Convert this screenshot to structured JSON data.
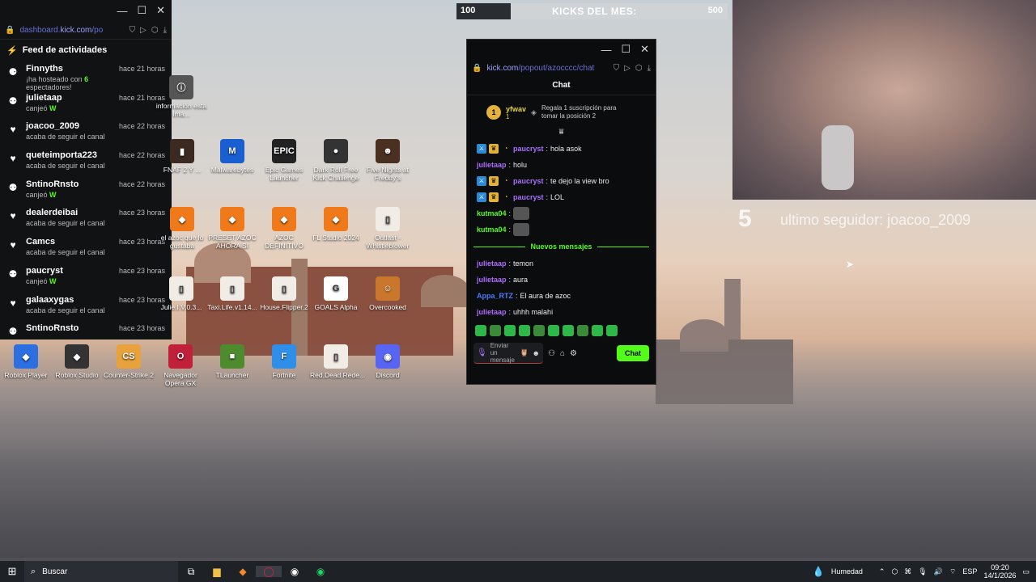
{
  "feed_window": {
    "controls": [
      "—",
      "☐",
      "✕"
    ],
    "url_prefix": "dashboard.",
    "url_host": "kick.com",
    "url_path": "/po",
    "header": "Feed de actividades",
    "items": [
      {
        "name": "Finnyths",
        "time": "hace 21 horas",
        "pre": "¡ha hosteado con ",
        "count": "6",
        "post": " espectadores!",
        "icon": "host-icon"
      },
      {
        "name": "julietaap",
        "time": "hace 21 horas",
        "pre": "canjeó ",
        "count": "W",
        "post": "",
        "icon": "redeem-icon"
      },
      {
        "name": "joacoo_2009",
        "time": "hace 22 horas",
        "pre": "acaba de seguir el canal",
        "count": "",
        "post": "",
        "icon": "heart-icon"
      },
      {
        "name": "queteimporta223",
        "time": "hace 22 horas",
        "pre": "acaba de seguir el canal",
        "count": "",
        "post": "",
        "icon": "heart-icon"
      },
      {
        "name": "SntinoRnsto",
        "time": "hace 22 horas",
        "pre": "canjeó ",
        "count": "W",
        "post": "",
        "icon": "redeem-icon"
      },
      {
        "name": "dealerdeibai",
        "time": "hace 23 horas",
        "pre": "acaba de seguir el canal",
        "count": "",
        "post": "",
        "icon": "heart-icon"
      },
      {
        "name": "Camcs",
        "time": "hace 23 horas",
        "pre": "acaba de seguir el canal",
        "count": "",
        "post": "",
        "icon": "heart-icon"
      },
      {
        "name": "paucryst",
        "time": "hace 23 horas",
        "pre": "canjeó ",
        "count": "W",
        "post": "",
        "icon": "redeem-icon"
      },
      {
        "name": "galaaxygas",
        "time": "hace 23 horas",
        "pre": "acaba de seguir el canal",
        "count": "",
        "post": "",
        "icon": "heart-icon"
      },
      {
        "name": "SntinoRnsto",
        "time": "hace 23 horas",
        "pre": "",
        "count": "",
        "post": "",
        "icon": "redeem-icon"
      }
    ]
  },
  "desktop_icons": [
    {
      "label": "información esta ima...",
      "icon": "info-icon"
    },
    {
      "label": "FNAF 2 Y ...",
      "icon": "game-icon"
    },
    {
      "label": "Malwarebytes",
      "icon": "malwarebytes-icon"
    },
    {
      "label": "Epic Games Launcher",
      "icon": "epic-games-icon"
    },
    {
      "label": "Dark Roll Free Kick Challenge",
      "icon": "ball-icon"
    },
    {
      "label": "Five Nights at Freddy's",
      "icon": "fnaf-icon"
    },
    {
      "label": "el azoc que lo gustaba",
      "icon": "fl-studio-icon"
    },
    {
      "label": "PRESET AZOC AHORA SI",
      "icon": "fl-studio-icon"
    },
    {
      "label": "AZOC DEFINITIVO",
      "icon": "fl-studio-icon"
    },
    {
      "label": "FL Studio 2024",
      "icon": "fl-studio-icon"
    },
    {
      "label": "Outlast - Whistleblower",
      "icon": "file-icon"
    },
    {
      "label": "Julie.I.V.0.3...",
      "icon": "file-icon"
    },
    {
      "label": "Taxi.Life.v1.14...",
      "icon": "file-icon"
    },
    {
      "label": "House.Flipper.2",
      "icon": "file-icon"
    },
    {
      "label": "GOALS Alpha",
      "icon": "goals-icon"
    },
    {
      "label": "Overcooked",
      "icon": "overcooked-icon"
    },
    {
      "label": "Roblox Player",
      "icon": "roblox-icon"
    },
    {
      "label": "Roblox Studio",
      "icon": "roblox-studio-icon"
    },
    {
      "label": "Counter-Strike 2",
      "icon": "cs2-icon"
    },
    {
      "label": "Navegador Opera GX",
      "icon": "opera-gx-icon"
    },
    {
      "label": "TLauncher",
      "icon": "minecraft-icon"
    },
    {
      "label": "Fortnite",
      "icon": "fortnite-icon"
    },
    {
      "label": "Red.Dead.Rede...",
      "icon": "file-icon"
    },
    {
      "label": "Discord",
      "icon": "discord-icon"
    }
  ],
  "kicks_bar": {
    "current": "100",
    "label": "KICKS DEL MES:",
    "goal": "500",
    "progress": 0.2
  },
  "chat_window": {
    "controls": [
      "—",
      "☐",
      "✕"
    ],
    "url_host": "kick.com",
    "url_path": "/popout/azocccc/chat",
    "title": "Chat",
    "pinned": {
      "rank": "1",
      "name": "yfwav",
      "sub_count": "1",
      "message": "Regala 1 suscripción para tomar la posición 2"
    },
    "messages": [
      {
        "user": "paucryst",
        "text": "hola asok",
        "color": "#a970ff",
        "badges": true
      },
      {
        "user": "julietaap",
        "text": "holu",
        "color": "#b06bff",
        "badges": false
      },
      {
        "user": "paucryst",
        "text": "te dejo la view bro",
        "color": "#a970ff",
        "badges": true
      },
      {
        "user": "paucryst",
        "text": "LOL",
        "color": "#a970ff",
        "badges": true
      },
      {
        "user": "kutma04",
        "text": "",
        "color": "#53fc18",
        "badges": false,
        "emote": true
      },
      {
        "user": "kutma04",
        "text": "",
        "color": "#53fc18",
        "badges": false,
        "emote": true
      }
    ],
    "divider": "Nuevos mensajes",
    "new_messages": [
      {
        "user": "julietaap",
        "text": "temon",
        "color": "#b06bff"
      },
      {
        "user": "julietaap",
        "text": "aura",
        "color": "#b06bff"
      },
      {
        "user": "Appa_RTZ",
        "text": "El aura de azoc",
        "color": "#4a7cff"
      },
      {
        "user": "julietaap",
        "text": "uhhh malahi",
        "color": "#b06bff"
      }
    ],
    "input_placeholder": "Enviar un mensaje",
    "send_label": "Chat",
    "accent": "#53fc18"
  },
  "overlay": {
    "count": "5",
    "last_follower": "ultimo seguidor: joacoo_2009"
  },
  "taskbar": {
    "search": "Buscar",
    "weather": "Humedad",
    "lang": "ESP",
    "time": "09:20",
    "date": "14/1/2026"
  }
}
